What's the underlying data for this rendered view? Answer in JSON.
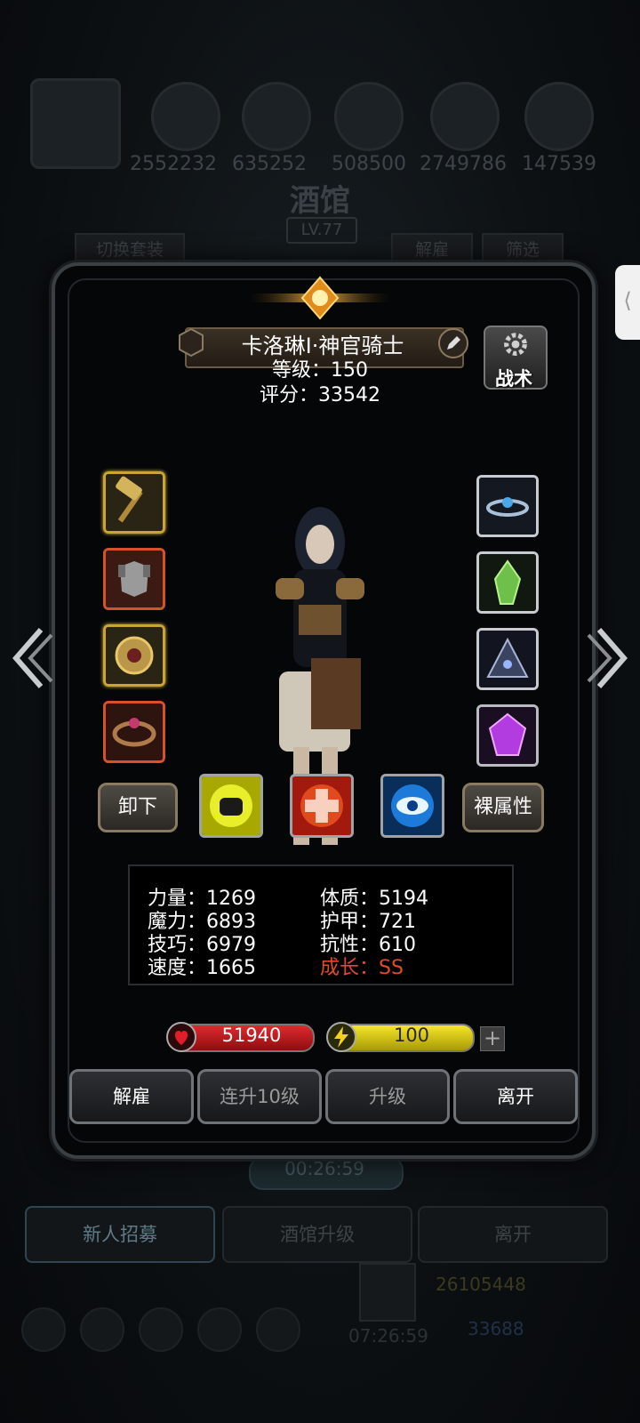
{
  "background": {
    "resources": [
      "2552232",
      "635252",
      "508500",
      "2749786",
      "147539"
    ],
    "title": "酒馆",
    "level": "LV.77",
    "tab_switch": "切换套装",
    "tab_dismiss": "解雇",
    "tab_filter": "筛选",
    "timer": "00:26:59",
    "bottom_buttons": [
      "新人招募",
      "酒馆升级",
      "离开"
    ],
    "gold": "26105448",
    "gems": "33688",
    "timer2": "07:26:59"
  },
  "hero": {
    "name": "卡洛琳Ⅰ·神官骑士",
    "level_text": "等级：150",
    "score_text": "评分：33542",
    "tactic_label": "战术",
    "unequip_label": "卸下",
    "bare_attr_label": "裸属性"
  },
  "stats": {
    "strength": "力量：1269",
    "magic": "魔力：6893",
    "skill": "技巧：6979",
    "speed": "速度：1665",
    "constitution": "体质：5194",
    "armor": "护甲：721",
    "resistance": "抗性：610",
    "growth": "成长：SS"
  },
  "bars": {
    "hp": "51940",
    "energy": "100",
    "hp_fill": 1.0,
    "energy_fill": 1.0
  },
  "actions": {
    "dismiss": "解雇",
    "level10": "连升10级",
    "upgrade": "升级",
    "leave": "离开"
  },
  "colors": {
    "growth": "#e24a2d",
    "hp": "#c4161c",
    "energy": "#d9c20e",
    "gold_border": "#c9a536"
  }
}
